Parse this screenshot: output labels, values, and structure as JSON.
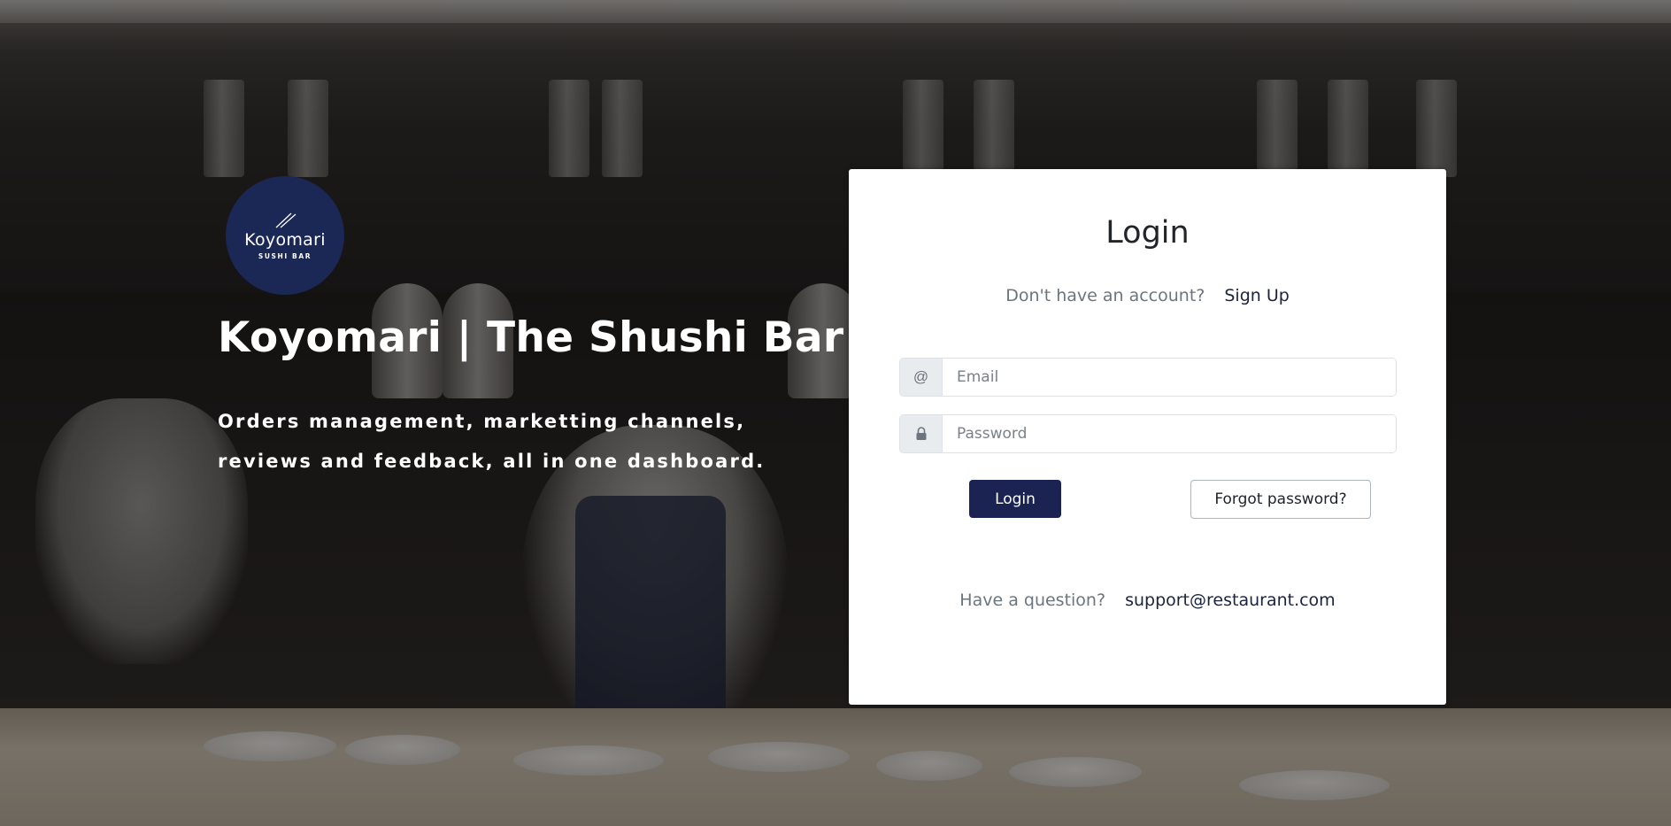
{
  "brand": {
    "logo_name": "Koyomari",
    "logo_sub": "SUSHI BAR",
    "hero_title": "Koyomari | The Shushi Bar",
    "hero_subtitle": "Orders management, marketting channels, reviews and feedback, all in one dashboard.",
    "logo_color": "#1b2755"
  },
  "login": {
    "title": "Login",
    "no_account_text": "Don't have an account?",
    "signup_label": "Sign Up",
    "email_addon": "@",
    "email_placeholder": "Email",
    "email_value": "",
    "password_addon_icon": "lock-icon",
    "password_placeholder": "Password",
    "password_value": "",
    "login_button": "Login",
    "forgot_button": "Forgot password?",
    "question_text": "Have a question?",
    "support_email": "support@restaurant.com",
    "primary_color": "#1b2352"
  }
}
